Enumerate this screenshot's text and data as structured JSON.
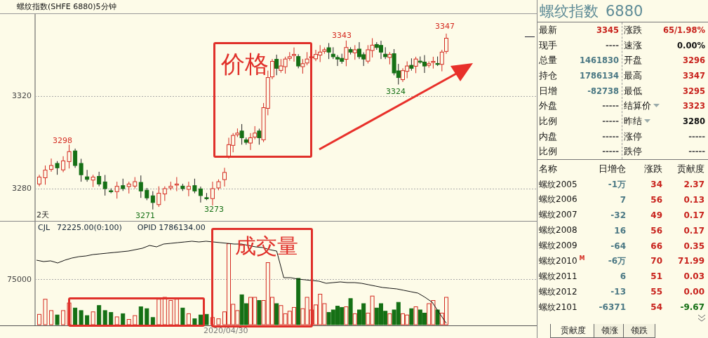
{
  "title": "螺纹指数(SHFE 6880)5分钟",
  "price_chart": {
    "y_labels": [
      "3320",
      "3280"
    ],
    "period_label": "2天",
    "price_marks": [
      {
        "text": "3298",
        "color": "#d42a20"
      },
      {
        "text": "3271",
        "color": "#157015"
      },
      {
        "text": "3273",
        "color": "#157015"
      },
      {
        "text": "3343",
        "color": "#d42a20"
      },
      {
        "text": "3324",
        "color": "#157015"
      },
      {
        "text": "3347",
        "color": "#d42a20"
      }
    ]
  },
  "volume_chart": {
    "indicator": "CJL",
    "volume_reading": "72225.00(0:100)",
    "oi_reading": "OPID 1786134.00",
    "y_label": "75000",
    "date_label": "2020/04/30"
  },
  "annotations": [
    {
      "kind": "box",
      "text": "价格"
    },
    {
      "kind": "box",
      "text": "成交量"
    },
    {
      "kind": "box"
    },
    {
      "kind": "arrow"
    }
  ],
  "quote": {
    "name": "螺纹指数",
    "code": "6880",
    "left": [
      {
        "label": "最新",
        "value": "3345",
        "color": "#c8221c"
      },
      {
        "label": "现手",
        "value": "----",
        "color": "#555555"
      },
      {
        "label": "总量",
        "value": "1461830",
        "color": "#4b7884"
      },
      {
        "label": "持仓",
        "value": "1786134",
        "color": "#4b7884"
      },
      {
        "label": "日增",
        "value": "-82738",
        "color": "#4b7884"
      },
      {
        "label": "外盘",
        "value": "-----",
        "color": "#555555"
      },
      {
        "label": "比例",
        "value": "-----",
        "color": "#555555"
      },
      {
        "label": "内盘",
        "value": "-----",
        "color": "#555555"
      },
      {
        "label": "比例",
        "value": "-----",
        "color": "#555555"
      }
    ],
    "right": [
      {
        "label": "涨跌",
        "value": "65/1.98%",
        "color": "#c8221c",
        "menu": false
      },
      {
        "label": "速涨",
        "value": "0.00%",
        "color": "#111111",
        "menu": false
      },
      {
        "label": "开盘",
        "value": "3296",
        "color": "#c8221c",
        "menu": false
      },
      {
        "label": "最高",
        "value": "3347",
        "color": "#c8221c",
        "menu": false
      },
      {
        "label": "最低",
        "value": "3295",
        "color": "#c8221c",
        "menu": false
      },
      {
        "label": "结算价",
        "value": "3323",
        "color": "#c8221c",
        "menu": true
      },
      {
        "label": "昨结",
        "value": "3280",
        "color": "#111111",
        "menu": true
      },
      {
        "label": "涨停",
        "value": "-----",
        "color": "#555555",
        "menu": false
      },
      {
        "label": "跌停",
        "value": "-----",
        "color": "#555555",
        "menu": false
      }
    ]
  },
  "contracts": {
    "columns": [
      "名称",
      "日增仓",
      "涨跌",
      "贡献度"
    ],
    "rows": [
      {
        "name": "螺纹2005",
        "oi_change": "-1万",
        "change": "34",
        "contribution": "2.37",
        "color": "#c8221c"
      },
      {
        "name": "螺纹2006",
        "oi_change": "7",
        "change": "56",
        "contribution": "0.13",
        "color": "#c8221c"
      },
      {
        "name": "螺纹2007",
        "oi_change": "-32",
        "change": "49",
        "contribution": "0.17",
        "color": "#c8221c"
      },
      {
        "name": "螺纹2008",
        "oi_change": "16",
        "change": "56",
        "contribution": "0.17",
        "color": "#c8221c"
      },
      {
        "name": "螺纹2009",
        "oi_change": "-64",
        "change": "66",
        "contribution": "0.35",
        "color": "#c8221c"
      },
      {
        "name": "螺纹2010",
        "badge": "M",
        "oi_change": "-6万",
        "change": "70",
        "contribution": "71.99",
        "color": "#c8221c"
      },
      {
        "name": "螺纹2011",
        "oi_change": "6",
        "change": "51",
        "contribution": "0.03",
        "color": "#c8221c"
      },
      {
        "name": "螺纹2012",
        "oi_change": "-13",
        "change": "55",
        "contribution": "0.00",
        "color": "#c8221c"
      },
      {
        "name": "螺纹2101",
        "oi_change": "-6371",
        "change": "54",
        "contribution": "-9.67",
        "color": "#157015"
      }
    ]
  },
  "tabs": [
    {
      "label": "贡献度",
      "selected": true
    },
    {
      "label": "领涨",
      "selected": false
    },
    {
      "label": "领跌",
      "selected": false
    }
  ]
}
